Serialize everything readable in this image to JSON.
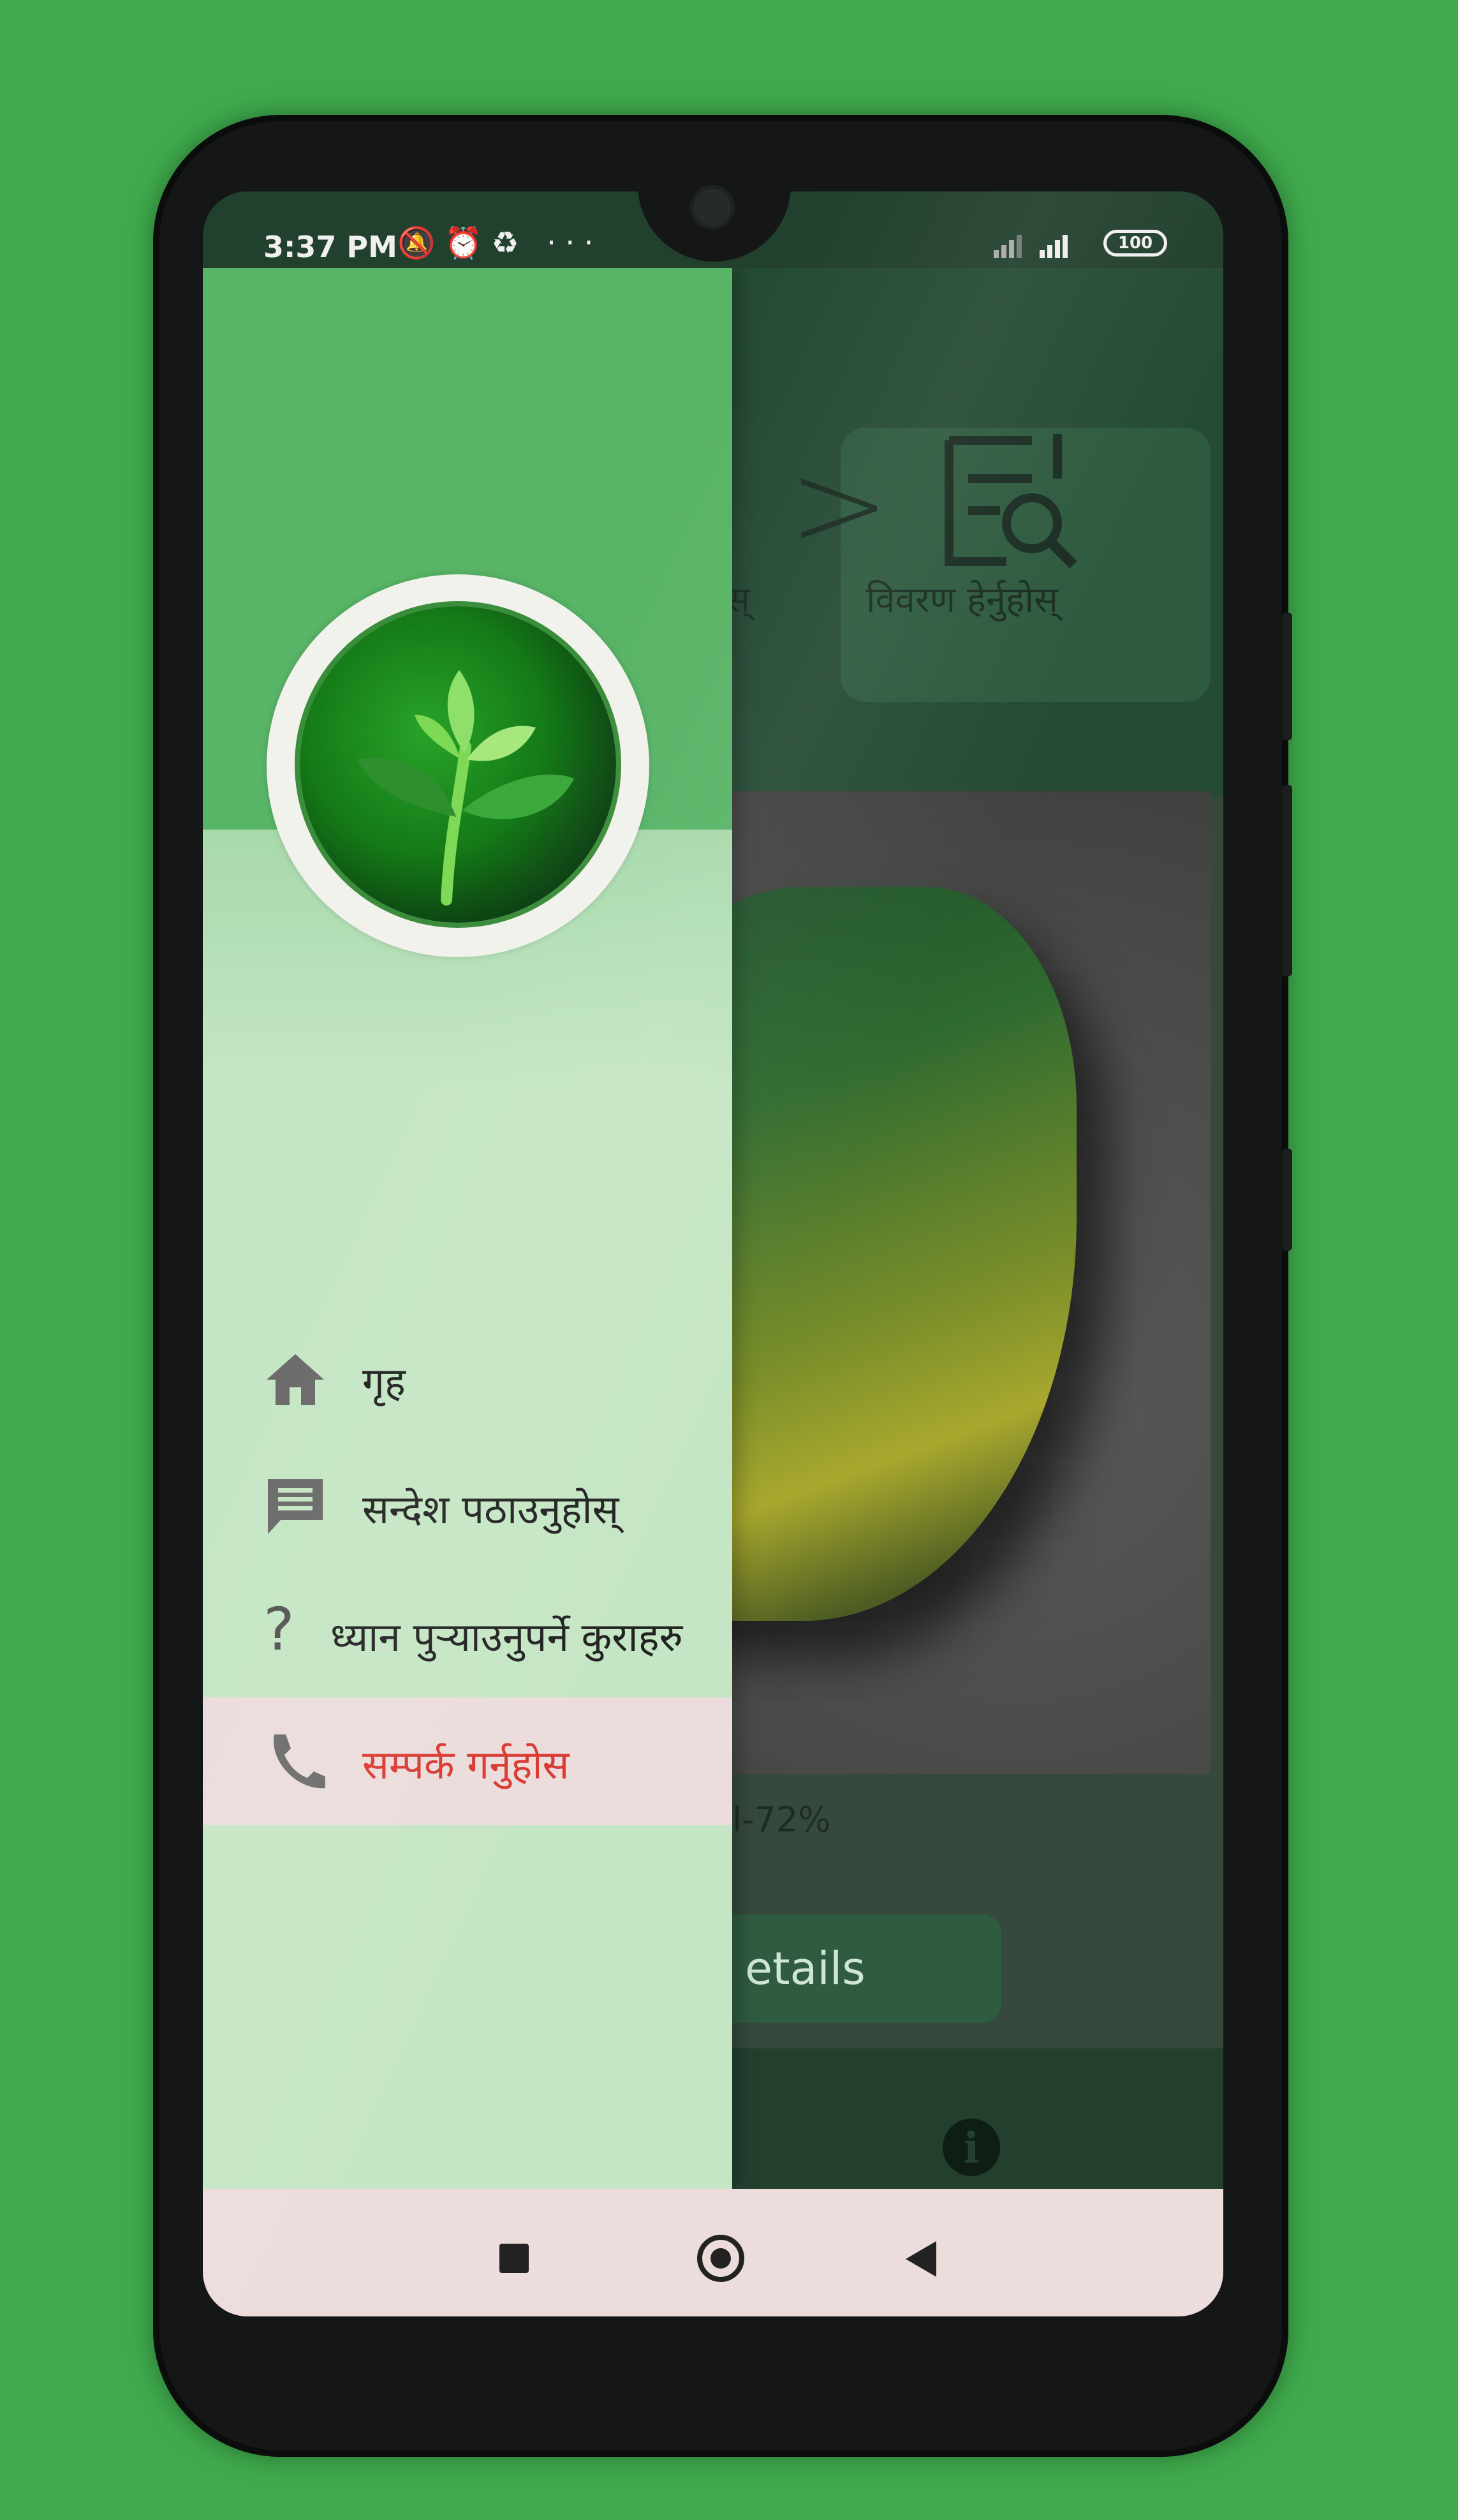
{
  "status_bar": {
    "time": "3:37 PM",
    "more": "···",
    "battery": "100"
  },
  "background_app": {
    "header_actions": [
      {
        "label": "स्"
      },
      {
        "label": "विवरण हेर्नुहोस्"
      }
    ],
    "confidence": "l-72%",
    "details_button": "etails"
  },
  "drawer": {
    "menu": [
      {
        "label": "गृह",
        "icon": "home-icon"
      },
      {
        "label": "सन्देश पठाउनुहोस्",
        "icon": "message-icon"
      },
      {
        "label": "ध्यान पुऱ्याउनुपर्ने कुराहरु",
        "icon": "help-icon"
      },
      {
        "label": "सम्पर्क गर्नुहोस",
        "icon": "phone-icon",
        "active": true
      }
    ]
  },
  "colors": {
    "drawer_header": "#58b466",
    "drawer_body": "#c5e6c4",
    "active_item_bg": "#ecdcdc",
    "active_item_text": "#d93a32",
    "app_primary": "#254a35"
  }
}
